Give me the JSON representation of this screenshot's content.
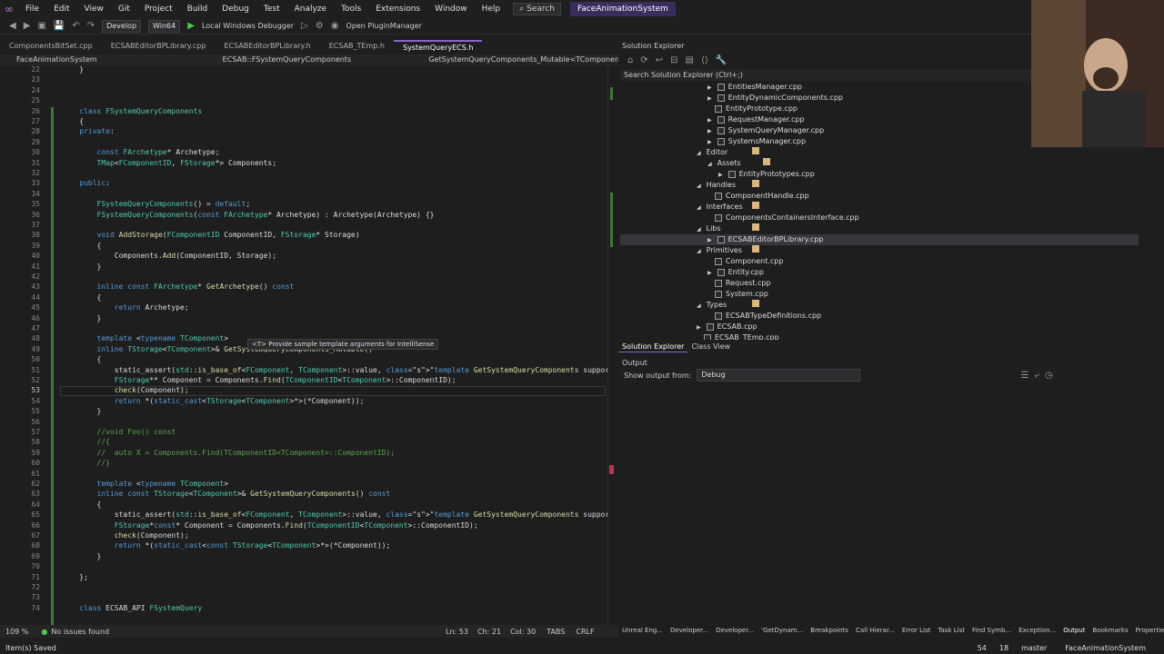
{
  "menu": {
    "items": [
      "File",
      "Edit",
      "View",
      "Git",
      "Project",
      "Build",
      "Debug",
      "Test",
      "Analyze",
      "Tools",
      "Extensions",
      "Window",
      "Help"
    ],
    "search": "Search",
    "solution": "FaceAnimationSystem"
  },
  "toolbar": {
    "config": "Develop",
    "platform": "Win64",
    "debugger": "Local Windows Debugger",
    "plugin": "Open PluginManager"
  },
  "tabs": [
    "ComponentsBitSet.cpp",
    "ECSABEditorBPLibrary.cpp",
    "ECSABEditorBPLibrary.h",
    "ECSAB_TEmp.h",
    "SystemQueryECS.h"
  ],
  "navbar": [
    "FaceAnimationSystem",
    "ECSAB::FSystemQueryComponents",
    "GetSystemQueryComponents_Mutable<TComponent>()"
  ],
  "editor": {
    "lines": [
      {
        "n": "22",
        "code": "    }"
      },
      {
        "n": "23",
        "code": ""
      },
      {
        "n": "24",
        "code": ""
      },
      {
        "n": "25",
        "code": ""
      },
      {
        "n": "26",
        "code": "    class FSystemQueryComponents"
      },
      {
        "n": "27",
        "code": "    {"
      },
      {
        "n": "28",
        "code": "    private:"
      },
      {
        "n": "29",
        "code": ""
      },
      {
        "n": "30",
        "code": "        const FArchetype* Archetype;"
      },
      {
        "n": "31",
        "code": "        TMap<FComponentID, FStorage*> Components;"
      },
      {
        "n": "32",
        "code": ""
      },
      {
        "n": "33",
        "code": "    public:"
      },
      {
        "n": "34",
        "code": ""
      },
      {
        "n": "35",
        "code": "        FSystemQueryComponents() = default;"
      },
      {
        "n": "36",
        "code": "        FSystemQueryComponents(const FArchetype* Archetype) : Archetype(Archetype) {}"
      },
      {
        "n": "37",
        "code": ""
      },
      {
        "n": "38",
        "code": "        void AddStorage(FComponentID ComponentID, FStorage* Storage)"
      },
      {
        "n": "39",
        "code": "        {"
      },
      {
        "n": "40",
        "code": "            Components.Add(ComponentID, Storage);"
      },
      {
        "n": "41",
        "code": "        }"
      },
      {
        "n": "42",
        "code": ""
      },
      {
        "n": "43",
        "code": "        inline const FArchetype* GetArchetype() const"
      },
      {
        "n": "44",
        "code": "        {"
      },
      {
        "n": "45",
        "code": "            return Archetype;"
      },
      {
        "n": "46",
        "code": "        }"
      },
      {
        "n": "47",
        "code": ""
      },
      {
        "n": "48",
        "code": "        template <typename TComponent>"
      },
      {
        "n": "49",
        "code": "        inline TStorage<TComponent>& GetSystemQueryComponents_Mutable()"
      },
      {
        "n": "50",
        "code": "        {"
      },
      {
        "n": "51",
        "code": "            static_assert(std::is_base_of<FComponent, TComponent>::value, \"template GetSystemQueryComponents suppor"
      },
      {
        "n": "52",
        "code": "            FStorage** Component = Components.Find(TComponentID<TComponent>::ComponentID);"
      },
      {
        "n": "53",
        "code": "            check(Component);"
      },
      {
        "n": "54",
        "code": "            return *(static_cast<TStorage<TComponent>*>(*Component));"
      },
      {
        "n": "55",
        "code": "        }"
      },
      {
        "n": "56",
        "code": ""
      },
      {
        "n": "57",
        "code": "        //void Foo() const"
      },
      {
        "n": "58",
        "code": "        //{"
      },
      {
        "n": "59",
        "code": "        //  auto X = Components.Find(TComponentID<TComponent>::ComponentID);"
      },
      {
        "n": "60",
        "code": "        //}"
      },
      {
        "n": "61",
        "code": ""
      },
      {
        "n": "62",
        "code": "        template <typename TComponent>"
      },
      {
        "n": "63",
        "code": "        inline const TStorage<TComponent>& GetSystemQueryComponents() const"
      },
      {
        "n": "64",
        "code": "        {"
      },
      {
        "n": "65",
        "code": "            static_assert(std::is_base_of<FComponent, TComponent>::value, \"template GetSystemQueryComponents suppor"
      },
      {
        "n": "66",
        "code": "            FStorage*const* Component = Components.Find(TComponentID<TComponent>::ComponentID);"
      },
      {
        "n": "67",
        "code": "            check(Component);"
      },
      {
        "n": "68",
        "code": "            return *(static_cast<const TStorage<TComponent>*>(*Component));"
      },
      {
        "n": "69",
        "code": "        }"
      },
      {
        "n": "70",
        "code": ""
      },
      {
        "n": "71",
        "code": "    };"
      },
      {
        "n": "72",
        "code": ""
      },
      {
        "n": "73",
        "code": ""
      },
      {
        "n": "74",
        "code": "    class ECSAB_API FSystemQuery"
      }
    ],
    "hint": "<T> Provide sample template arguments for IntelliSense"
  },
  "status_editor": {
    "zoom": "109 %",
    "issues": "No issues found",
    "ln": "Ln: 53",
    "ch": "Ch: 21",
    "col": "Col: 30",
    "tabs": "TABS",
    "crlf": "CRLF"
  },
  "solution_explorer": {
    "title": "Solution Explorer",
    "search": "Search Solution Explorer (Ctrl+;)",
    "nodes": [
      {
        "label": "EntitiesManager.cpp",
        "depth": 3,
        "type": "cpp",
        "arrow": "▶"
      },
      {
        "label": "EntityDynamicComponents.cpp",
        "depth": 3,
        "type": "cpp",
        "arrow": "▶"
      },
      {
        "label": "EntityPrototype.cpp",
        "depth": 3,
        "type": "cpp",
        "arrow": ""
      },
      {
        "label": "RequestManager.cpp",
        "depth": 3,
        "type": "cpp",
        "arrow": "▶"
      },
      {
        "label": "SystemQueryManager.cpp",
        "depth": 3,
        "type": "cpp",
        "arrow": "▶"
      },
      {
        "label": "SystemsManager.cpp",
        "depth": 3,
        "type": "cpp",
        "arrow": "▶"
      },
      {
        "label": "Editor",
        "depth": 2,
        "type": "folder",
        "arrow": "◢"
      },
      {
        "label": "Assets",
        "depth": 3,
        "type": "folder",
        "arrow": "◢"
      },
      {
        "label": "EntityPrototypes.cpp",
        "depth": 4,
        "type": "cpp",
        "arrow": "▶"
      },
      {
        "label": "Handles",
        "depth": 2,
        "type": "folder",
        "arrow": "◢"
      },
      {
        "label": "ComponentHandle.cpp",
        "depth": 3,
        "type": "cpp",
        "arrow": ""
      },
      {
        "label": "Interfaces",
        "depth": 2,
        "type": "folder",
        "arrow": "◢"
      },
      {
        "label": "ComponentsContainersInterface.cpp",
        "depth": 3,
        "type": "cpp",
        "arrow": ""
      },
      {
        "label": "Libs",
        "depth": 2,
        "type": "folder",
        "arrow": "◢"
      },
      {
        "label": "ECSABEditorBPLibrary.cpp",
        "depth": 3,
        "type": "cpp",
        "arrow": "▶",
        "selected": true
      },
      {
        "label": "Primitives",
        "depth": 2,
        "type": "folder",
        "arrow": "◢"
      },
      {
        "label": "Component.cpp",
        "depth": 3,
        "type": "cpp",
        "arrow": ""
      },
      {
        "label": "Entity.cpp",
        "depth": 3,
        "type": "cpp",
        "arrow": "▶"
      },
      {
        "label": "Request.cpp",
        "depth": 3,
        "type": "cpp",
        "arrow": ""
      },
      {
        "label": "System.cpp",
        "depth": 3,
        "type": "cpp",
        "arrow": ""
      },
      {
        "label": "Types",
        "depth": 2,
        "type": "folder",
        "arrow": "◢"
      },
      {
        "label": "ECSABTypeDefinitions.cpp",
        "depth": 3,
        "type": "cpp",
        "arrow": ""
      },
      {
        "label": "ECSAB.cpp",
        "depth": 2,
        "type": "cpp",
        "arrow": "▶"
      },
      {
        "label": "ECSAB_TEmp.cpp",
        "depth": 2,
        "type": "cpp",
        "arrow": ""
      }
    ],
    "bottom_tabs": [
      "Solution Explorer",
      "Class View"
    ]
  },
  "output": {
    "title": "Output",
    "show_from_label": "Show output from:",
    "source": "Debug"
  },
  "bottom_tabs": [
    "Unreal Eng...",
    "Developer...",
    "Developer...",
    "'GetDynam...",
    "Breakpoints",
    "Call Hierar...",
    "Error List",
    "Task List",
    "Find Symb...",
    "Exception...",
    "Output",
    "Bookmarks",
    "Properties"
  ],
  "statusbar": {
    "left": "Item(s) Saved",
    "errors": "54",
    "arrows": "18",
    "branch": "master",
    "project": "FaceAnimationSystem"
  }
}
